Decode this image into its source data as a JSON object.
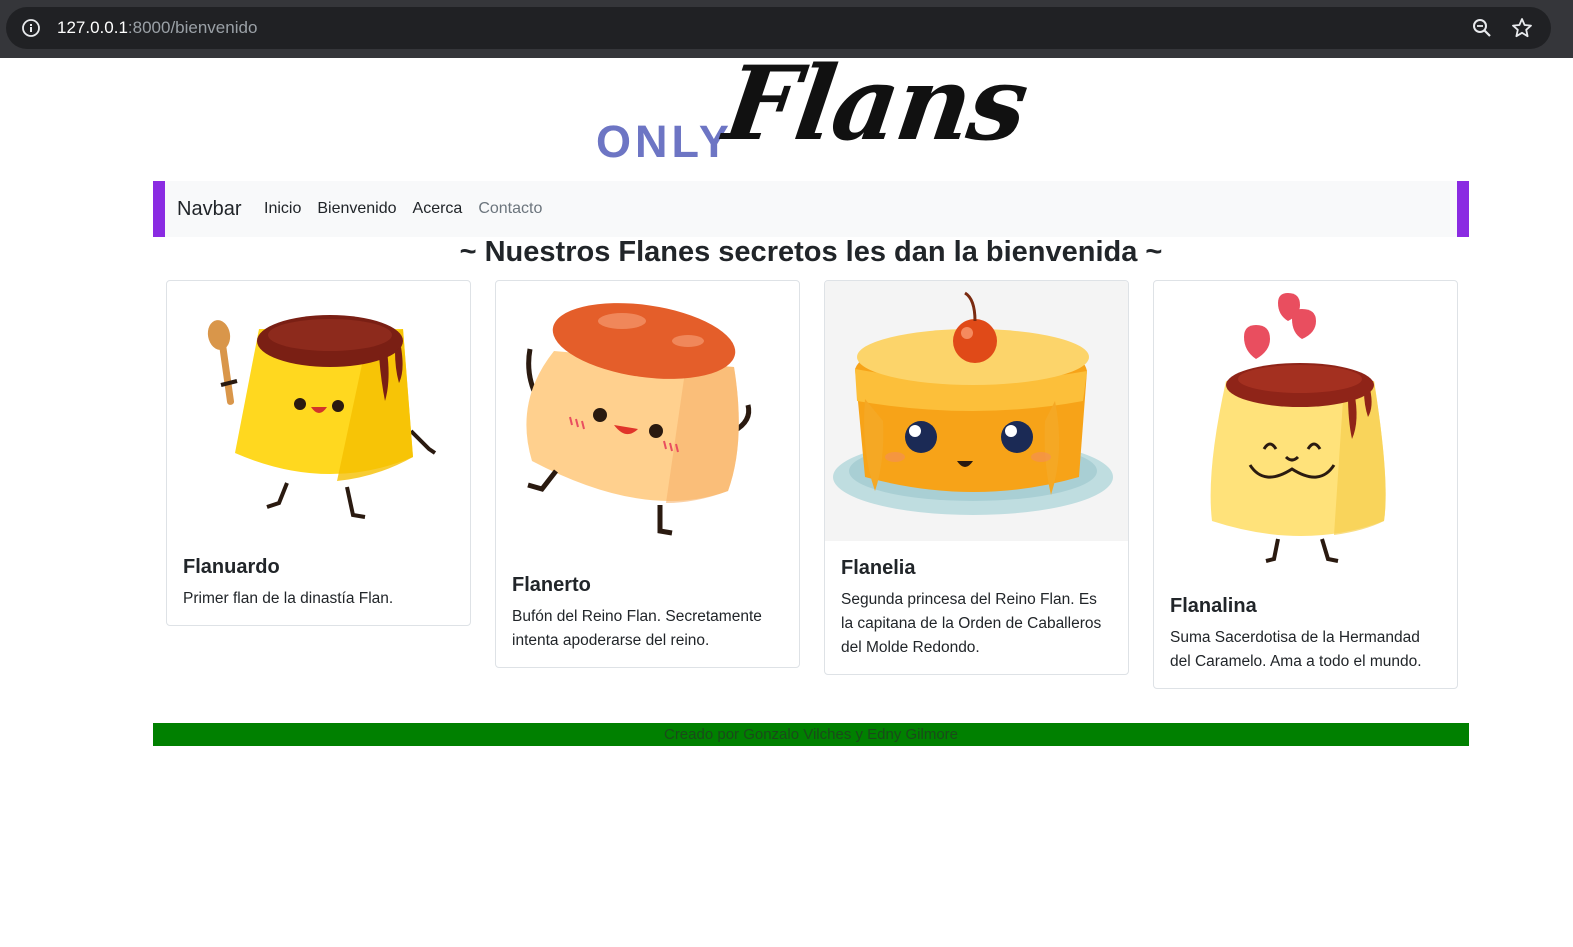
{
  "browser": {
    "url_host": "127.0.0.1",
    "url_rest": ":8000/bienvenido"
  },
  "logo": {
    "only": "ONLY",
    "flans": "Flans"
  },
  "navbar": {
    "brand": "Navbar",
    "links": [
      {
        "label": "Inicio"
      },
      {
        "label": "Bienvenido"
      },
      {
        "label": "Acerca"
      },
      {
        "label": "Contacto"
      }
    ]
  },
  "heading": "~ Nuestros Flanes secretos les dan la bienvenida ~",
  "cards": [
    {
      "title": "Flanuardo",
      "text": "Primer flan de la dinastía Flan."
    },
    {
      "title": "Flanerto",
      "text": "Bufón del Reino Flan. Secretamente intenta apoderarse del reino."
    },
    {
      "title": "Flanelia",
      "text": "Segunda princesa del Reino Flan. Es la capitana de la Orden de Caballeros del Molde Redondo."
    },
    {
      "title": "Flanalina",
      "text": "Suma Sacerdotisa de la Hermandad del Caramelo. Ama a todo el mundo."
    }
  ],
  "footer": "Creado por Gonzalo Vilches y Edny Gilmore",
  "colors": {
    "navbar_accent": "#8a2be2",
    "footer_bg": "#008000",
    "logo_only": "#6d75c4"
  }
}
